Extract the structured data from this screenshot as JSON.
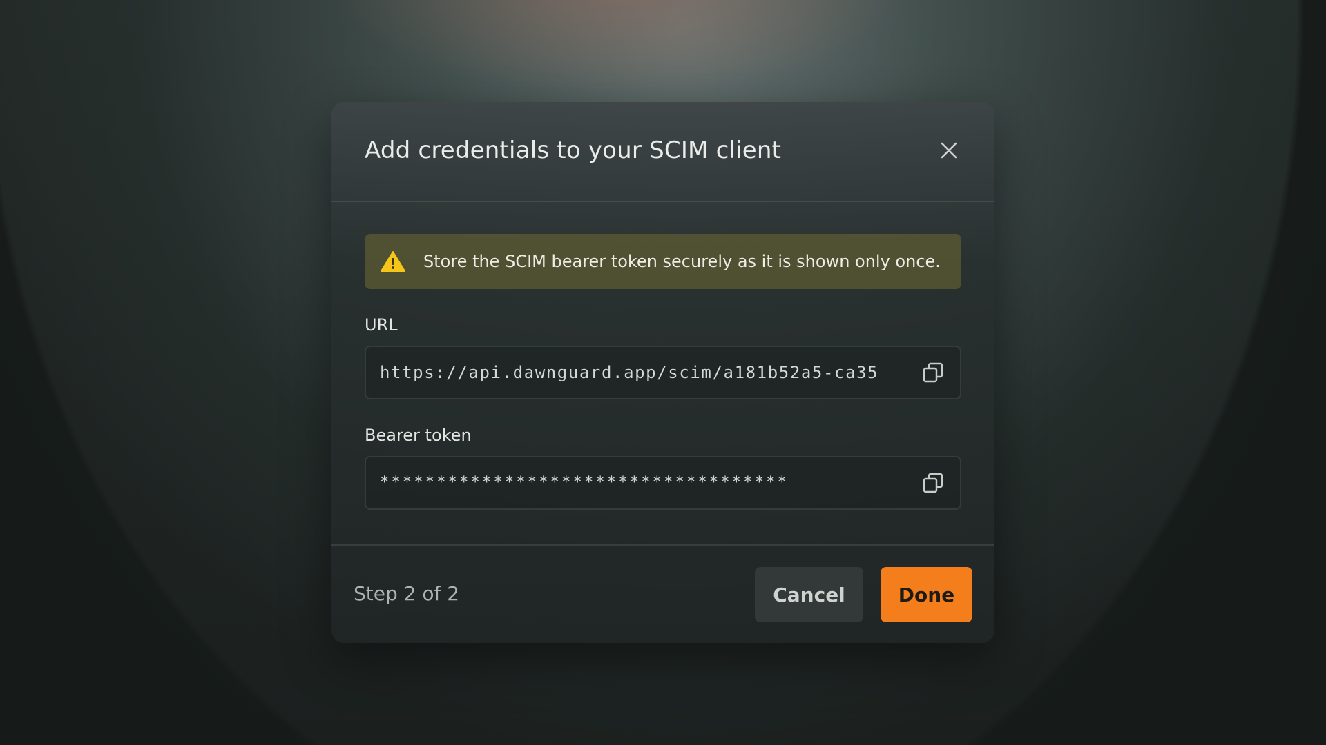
{
  "dialog": {
    "title": "Add credentials to your SCIM client",
    "close_icon": "close-icon",
    "warning": {
      "icon": "warning-triangle-icon",
      "text": "Store the SCIM bearer token securely as it is shown only once.",
      "color": "#f5c518"
    },
    "fields": {
      "url": {
        "label": "URL",
        "value": "https://api.dawnguard.app/scim/a181b52a5-ca35",
        "copy_icon": "copy-icon"
      },
      "token": {
        "label": "Bearer token",
        "value": "************************************",
        "copy_icon": "copy-icon"
      }
    },
    "footer": {
      "step": "Step 2 of 2",
      "cancel_label": "Cancel",
      "done_label": "Done"
    }
  },
  "colors": {
    "accent": "#f57e1c",
    "warning_bg": "#68643a"
  }
}
